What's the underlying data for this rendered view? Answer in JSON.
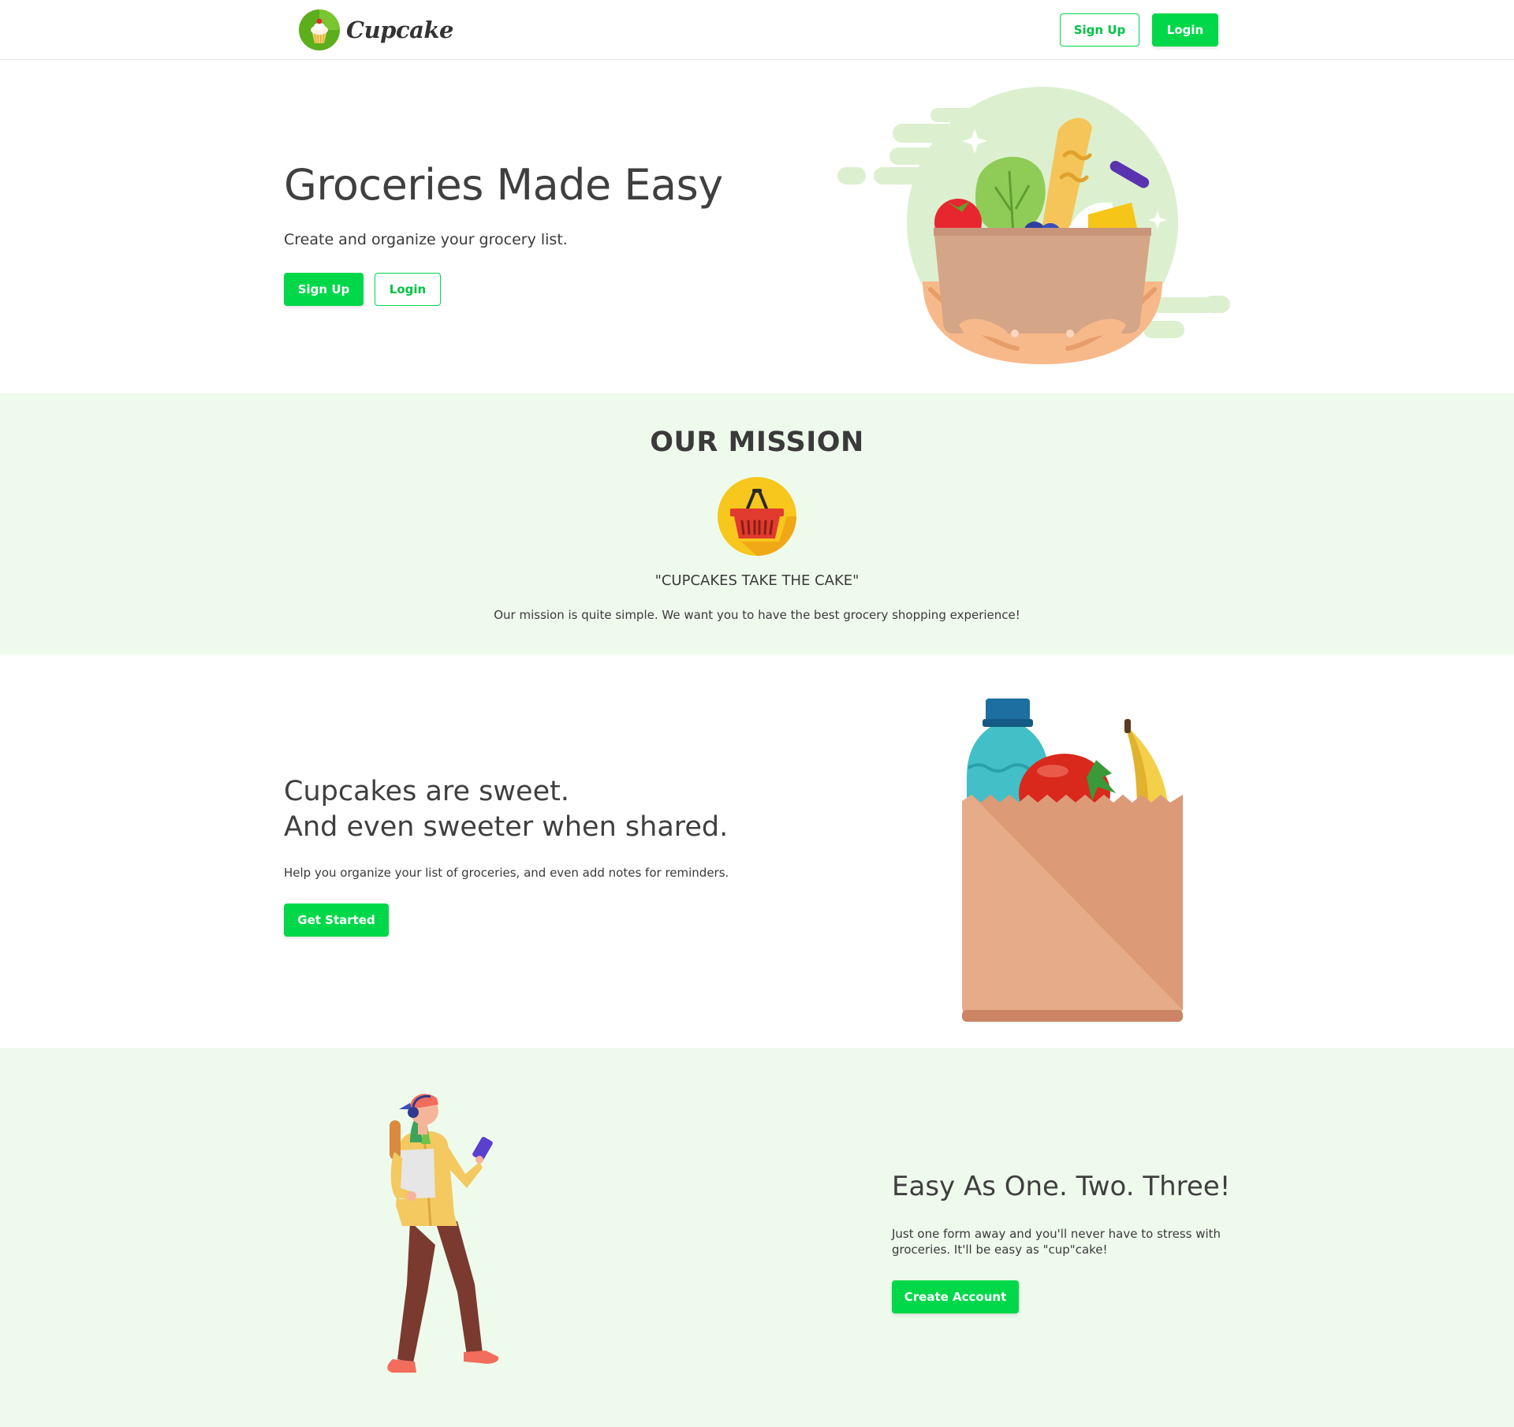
{
  "navbar": {
    "brand": "Cupcake",
    "signup_label": "Sign Up",
    "login_label": "Login"
  },
  "hero": {
    "title": "Groceries Made Easy",
    "subtitle": "Create and organize your grocery list.",
    "signup_label": "Sign Up",
    "login_label": "Login"
  },
  "mission": {
    "title": "OUR MISSION",
    "quote": "\"CUPCAKES TAKE THE CAKE\"",
    "text": "Our mission is quite simple. We want you to have the best grocery shopping experience!"
  },
  "sweet": {
    "title_line1": "Cupcakes are sweet.",
    "title_line2": "And even sweeter when shared.",
    "text": "Help you organize your list of groceries, and even add notes for reminders.",
    "button_label": "Get Started"
  },
  "easy": {
    "title": "Easy As One. Two. Three!",
    "text": "Just one form away and you'll never have to stress with groceries. It'll be easy as \"cup\"cake!",
    "button_label": "Create Account"
  },
  "colors": {
    "accent": "#00d84a",
    "mission_bg": "#eefbec",
    "text": "#3d3d3d"
  },
  "icons": [
    "cupcake-logo-icon",
    "basket-icon"
  ]
}
